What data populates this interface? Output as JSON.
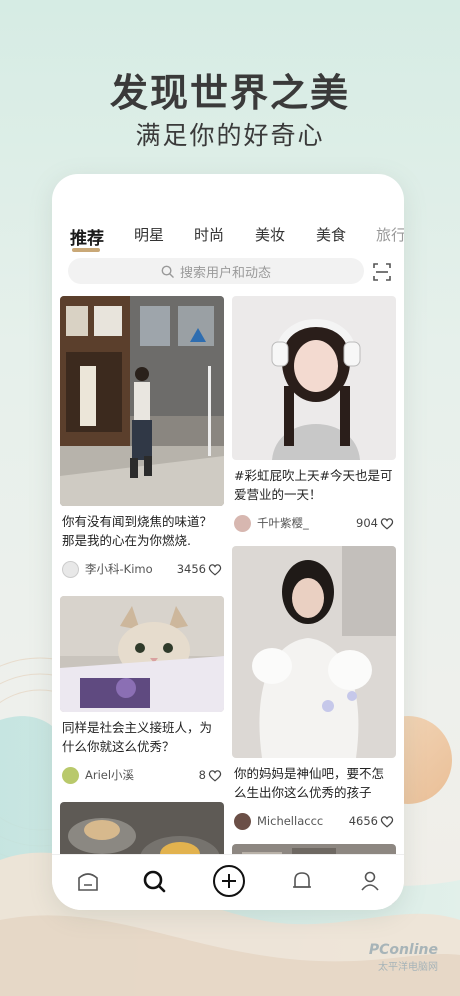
{
  "headline": {
    "title": "发现世界之美",
    "subtitle": "满足你的好奇心"
  },
  "tabs": [
    {
      "label": "推荐",
      "active": true
    },
    {
      "label": "明星",
      "active": false
    },
    {
      "label": "时尚",
      "active": false
    },
    {
      "label": "美妆",
      "active": false
    },
    {
      "label": "美食",
      "active": false
    },
    {
      "label": "旅行",
      "active": false
    }
  ],
  "search": {
    "placeholder": "搜索用户和动态",
    "icon": "search-icon",
    "scan_icon": "scan-icon"
  },
  "feed": {
    "left": [
      {
        "caption": "你有没有闻到烧焦的味道？那是我的心在为你燃烧.",
        "author": "李小科-Kimo",
        "likes": "3456",
        "image": "street-photo"
      },
      {
        "caption": "同样是社会主义接班人，为什么你就这么优秀？",
        "author": "Ariel小溪",
        "likes": "8",
        "image": "cat-photo"
      },
      {
        "caption": "",
        "author": "",
        "likes": "",
        "image": "dessert-photo"
      }
    ],
    "right": [
      {
        "caption": "#彩虹屁吹上天#今天也是可爱营业的一天！",
        "author": "千叶紫樱_",
        "likes": "904",
        "image": "headphones-girl-photo"
      },
      {
        "caption": "你的妈妈是神仙吧，要不怎么生出你这么优秀的孩子",
        "author": "Michellaccc",
        "likes": "4656",
        "image": "white-dress-photo"
      },
      {
        "caption": "",
        "author": "",
        "likes": "",
        "image": "interior-photo"
      }
    ]
  },
  "bottom_nav": [
    "home-icon",
    "discover-icon",
    "publish-icon",
    "notification-icon",
    "profile-icon"
  ],
  "watermark": {
    "brand": "PConline",
    "sub": "太平洋电脑网"
  },
  "colors": {
    "accent": "#c9a877",
    "background": "#d6ece4"
  }
}
